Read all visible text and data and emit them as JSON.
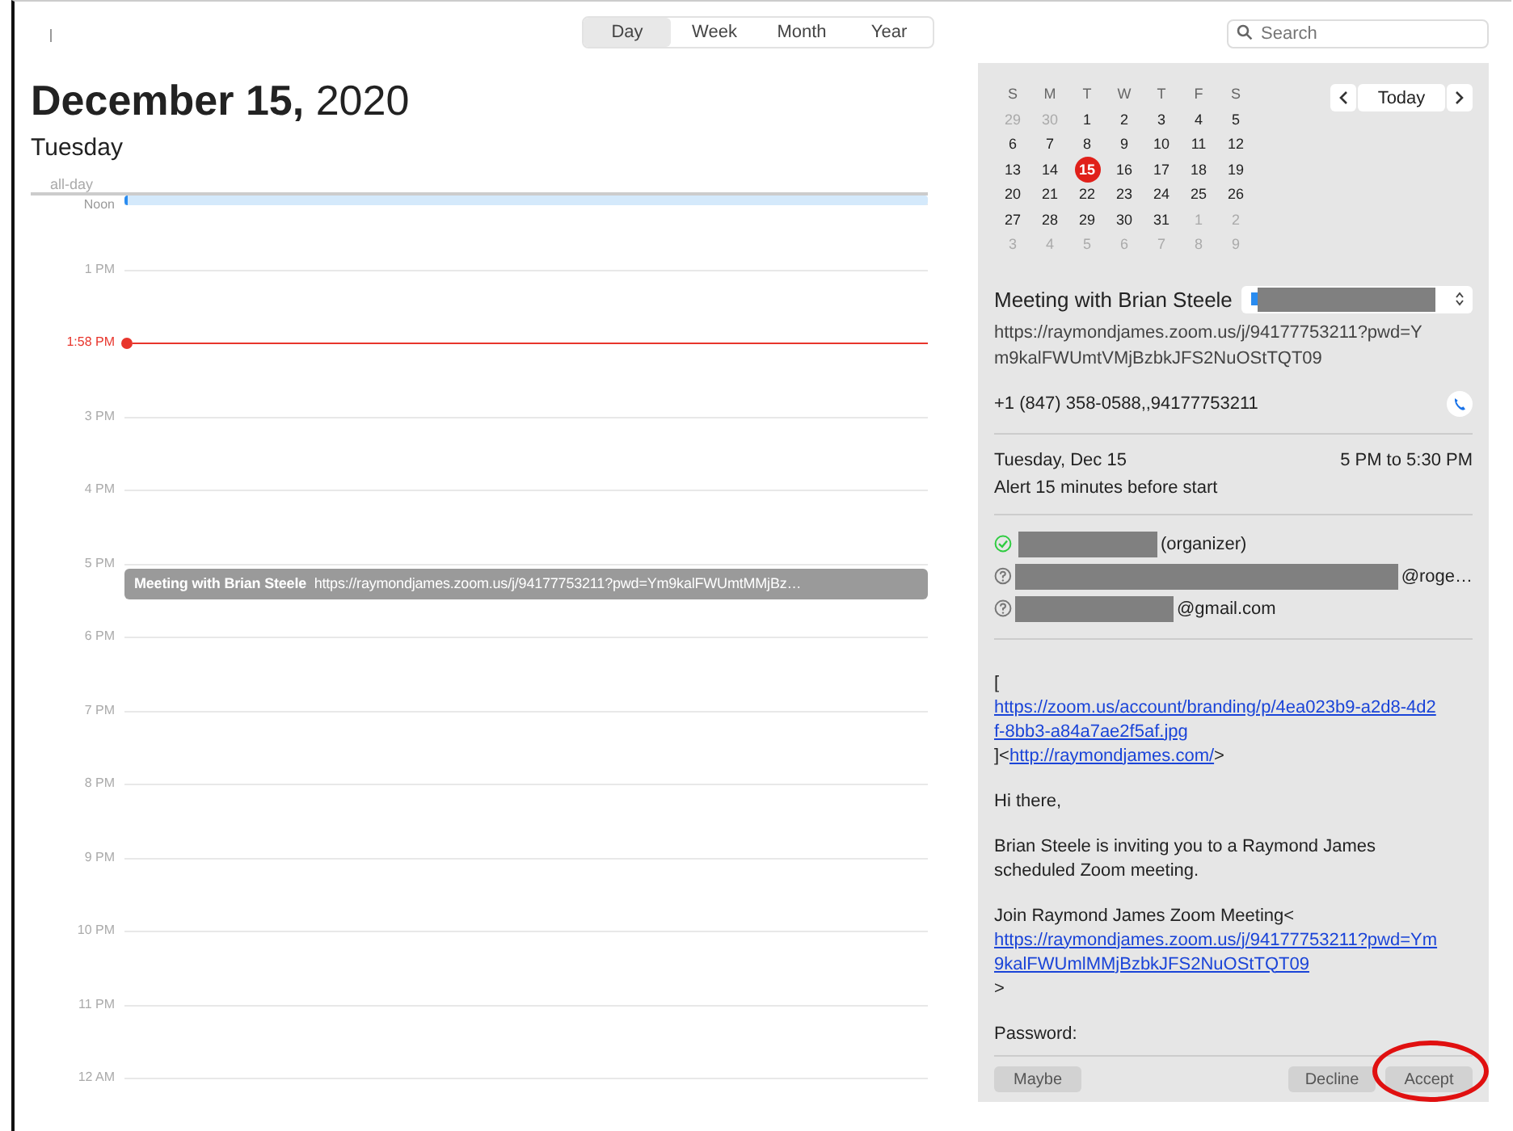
{
  "toolbar": {
    "views": [
      {
        "label": "Day",
        "selected": true
      },
      {
        "label": "Week",
        "selected": false
      },
      {
        "label": "Month",
        "selected": false
      },
      {
        "label": "Year",
        "selected": false
      }
    ],
    "search": {
      "placeholder": "Search"
    }
  },
  "day_view": {
    "date_bold": "December 15,",
    "year": "2020",
    "weekday": "Tuesday",
    "all_day_label": "all-day",
    "hours": [
      {
        "label": "Noon",
        "kind": "hour"
      },
      {
        "label": "1 PM",
        "kind": "hour"
      },
      {
        "label": "1:58 PM",
        "kind": "now"
      },
      {
        "label": "3 PM",
        "kind": "hour"
      },
      {
        "label": "4 PM",
        "kind": "hour"
      },
      {
        "label": "5 PM",
        "kind": "hour",
        "event": {
          "title": "Meeting with Brian Steele",
          "detail": "https://raymondjames.zoom.us/j/94177753211?pwd=Ym9kalFWUmtMMjBz…"
        }
      },
      {
        "label": "6 PM",
        "kind": "hour"
      },
      {
        "label": "7 PM",
        "kind": "hour"
      },
      {
        "label": "8 PM",
        "kind": "hour"
      },
      {
        "label": "9 PM",
        "kind": "hour"
      },
      {
        "label": "10 PM",
        "kind": "hour"
      },
      {
        "label": "11 PM",
        "kind": "hour"
      },
      {
        "label": "12 AM",
        "kind": "hour"
      }
    ]
  },
  "mini_calendar": {
    "today_button": "Today",
    "weekdays": [
      "S",
      "M",
      "T",
      "W",
      "T",
      "F",
      "S"
    ],
    "weeks": [
      [
        {
          "day": "29",
          "in_month": false,
          "selected": false
        },
        {
          "day": "30",
          "in_month": false,
          "selected": false
        },
        {
          "day": "1",
          "in_month": true,
          "selected": false
        },
        {
          "day": "2",
          "in_month": true,
          "selected": false
        },
        {
          "day": "3",
          "in_month": true,
          "selected": false
        },
        {
          "day": "4",
          "in_month": true,
          "selected": false
        },
        {
          "day": "5",
          "in_month": true,
          "selected": false
        }
      ],
      [
        {
          "day": "6",
          "in_month": true,
          "selected": false
        },
        {
          "day": "7",
          "in_month": true,
          "selected": false
        },
        {
          "day": "8",
          "in_month": true,
          "selected": false
        },
        {
          "day": "9",
          "in_month": true,
          "selected": false
        },
        {
          "day": "10",
          "in_month": true,
          "selected": false
        },
        {
          "day": "11",
          "in_month": true,
          "selected": false
        },
        {
          "day": "12",
          "in_month": true,
          "selected": false
        }
      ],
      [
        {
          "day": "13",
          "in_month": true,
          "selected": false
        },
        {
          "day": "14",
          "in_month": true,
          "selected": false
        },
        {
          "day": "15",
          "in_month": true,
          "selected": true
        },
        {
          "day": "16",
          "in_month": true,
          "selected": false
        },
        {
          "day": "17",
          "in_month": true,
          "selected": false
        },
        {
          "day": "18",
          "in_month": true,
          "selected": false
        },
        {
          "day": "19",
          "in_month": true,
          "selected": false
        }
      ],
      [
        {
          "day": "20",
          "in_month": true,
          "selected": false
        },
        {
          "day": "21",
          "in_month": true,
          "selected": false
        },
        {
          "day": "22",
          "in_month": true,
          "selected": false
        },
        {
          "day": "23",
          "in_month": true,
          "selected": false
        },
        {
          "day": "24",
          "in_month": true,
          "selected": false
        },
        {
          "day": "25",
          "in_month": true,
          "selected": false
        },
        {
          "day": "26",
          "in_month": true,
          "selected": false
        }
      ],
      [
        {
          "day": "27",
          "in_month": true,
          "selected": false
        },
        {
          "day": "28",
          "in_month": true,
          "selected": false
        },
        {
          "day": "29",
          "in_month": true,
          "selected": false
        },
        {
          "day": "30",
          "in_month": true,
          "selected": false
        },
        {
          "day": "31",
          "in_month": true,
          "selected": false
        },
        {
          "day": "1",
          "in_month": false,
          "selected": false
        },
        {
          "day": "2",
          "in_month": false,
          "selected": false
        }
      ],
      [
        {
          "day": "3",
          "in_month": false,
          "selected": false
        },
        {
          "day": "4",
          "in_month": false,
          "selected": false
        },
        {
          "day": "5",
          "in_month": false,
          "selected": false
        },
        {
          "day": "6",
          "in_month": false,
          "selected": false
        },
        {
          "day": "7",
          "in_month": false,
          "selected": false
        },
        {
          "day": "8",
          "in_month": false,
          "selected": false
        },
        {
          "day": "9",
          "in_month": false,
          "selected": false
        }
      ]
    ]
  },
  "event": {
    "title": "Meeting with Brian Steele",
    "url": "https://raymondjames.zoom.us/j/94177753211?pwd=Ym9kalFWUmtVMjBzbkJFS2NuOStTQT09",
    "phone": "+1 (847) 358-0588,,94177753211",
    "date": "Tuesday, Dec 15",
    "time": "5 PM to 5:30 PM",
    "alert": "Alert 15 minutes before start",
    "invitees": [
      {
        "accepted": true,
        "suffix": "(organizer)"
      },
      {
        "accepted": false,
        "suffix": "@roge…"
      },
      {
        "accepted": false,
        "suffix": "@gmail.com"
      }
    ],
    "notes": [
      [
        {
          "text": "[",
          "kind": "text"
        },
        {
          "text": "https://zoom.us/account/branding/p/4ea023b9-a2d8-4d2f-8bb3-a84a7ae2f5af.jpg",
          "kind": "link"
        },
        {
          "text": "]<",
          "kind": "text"
        },
        {
          "text": "http://raymondjames.com/",
          "kind": "link"
        },
        {
          "text": ">",
          "kind": "text"
        }
      ],
      [
        {
          "text": "Hi there,",
          "kind": "text"
        }
      ],
      [
        {
          "text": "Brian Steele is inviting you to a Raymond James scheduled Zoom meeting.",
          "kind": "text"
        }
      ],
      [
        {
          "text": "Join Raymond James Zoom Meeting<",
          "kind": "text"
        },
        {
          "text": "https://raymondjames.zoom.us/j/94177753211?pwd=Ym9kalFWUmlMMjBzbkJFS2NuOStTQT09",
          "kind": "link"
        },
        {
          "text": ">",
          "kind": "text"
        }
      ],
      [
        {
          "text": "Password:",
          "kind": "text"
        }
      ]
    ],
    "buttons": {
      "maybe": "Maybe",
      "decline": "Decline",
      "accept": "Accept"
    }
  }
}
